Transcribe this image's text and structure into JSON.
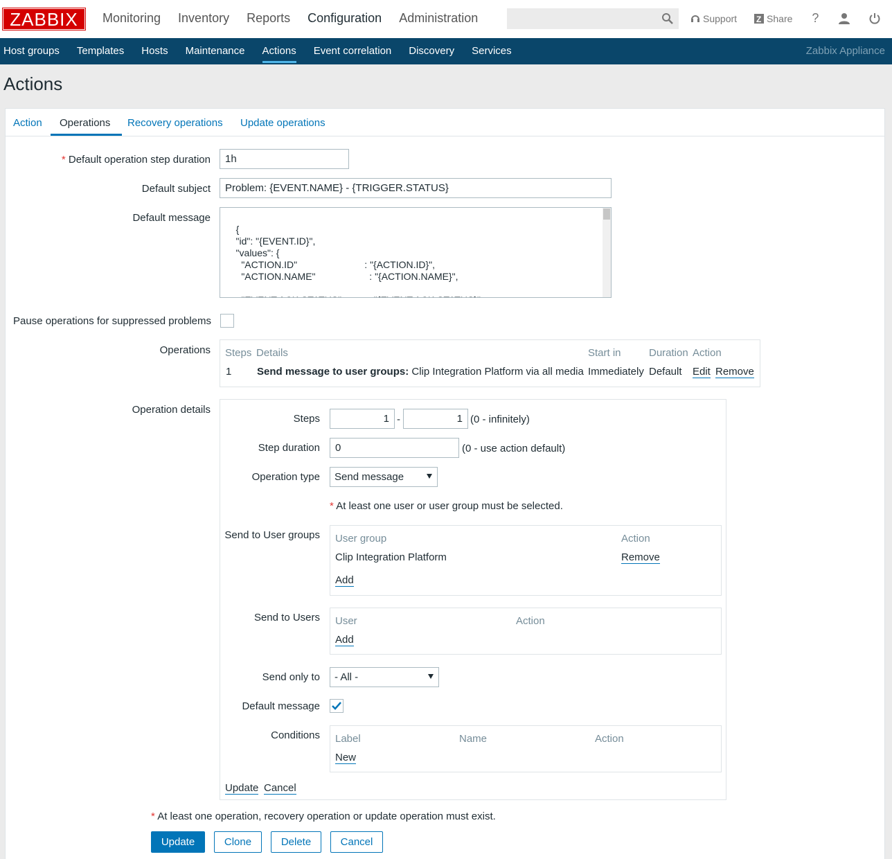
{
  "brand": "ZABBIX",
  "top_menu": [
    "Monitoring",
    "Inventory",
    "Reports",
    "Configuration",
    "Administration"
  ],
  "top_icons": {
    "support": "Support",
    "share": "Share",
    "help": "?"
  },
  "sub_menu": [
    "Host groups",
    "Templates",
    "Hosts",
    "Maintenance",
    "Actions",
    "Event correlation",
    "Discovery",
    "Services"
  ],
  "appliance": "Zabbix Appliance",
  "page_title": "Actions",
  "tabs": [
    "Action",
    "Operations",
    "Recovery operations",
    "Update operations"
  ],
  "form": {
    "step_duration_label": "Default operation step duration",
    "step_duration_value": "1h",
    "subject_label": "Default subject",
    "subject_value": "Problem: {EVENT.NAME} - {TRIGGER.STATUS}",
    "message_label": "Default message",
    "message_value": "{\n    \"id\": \"{EVENT.ID}\",\n    \"values\": {\n      \"ACTION.ID\"                         : \"{ACTION.ID}\",\n      \"ACTION.NAME\"                    : \"{ACTION.NAME}\",\n\n      \"EVENT.ACK.STATUS\"          : \"{EVENT.ACK.STATUS}\",\n      \"EVENT.AGE\"                        : \"{EVENT.AGE}\",",
    "pause_label": "Pause operations for suppressed problems",
    "operations_label": "Operations",
    "operations_table": {
      "headers": [
        "Steps",
        "Details",
        "Start in",
        "Duration",
        "Action"
      ],
      "row": {
        "steps": "1",
        "details_bold": "Send message to user groups:",
        "details_rest": " Clip Integration Platform via all media",
        "start_in": "Immediately",
        "duration": "Default",
        "edit": "Edit",
        "remove": "Remove"
      }
    },
    "operation_details_label": "Operation details"
  },
  "details": {
    "steps_label": "Steps",
    "steps_from": "1",
    "steps_dash": "-",
    "steps_to": "1",
    "steps_hint": "(0 - infinitely)",
    "step_duration_label": "Step duration",
    "step_duration_value": "0",
    "step_duration_hint": "(0 - use action default)",
    "operation_type_label": "Operation type",
    "operation_type_value": "Send message",
    "warning": "At least one user or user group must be selected.",
    "user_groups_label": "Send to User groups",
    "user_groups_headers": [
      "User group",
      "Action"
    ],
    "user_group_name": "Clip Integration Platform",
    "user_group_remove": "Remove",
    "user_groups_add": "Add",
    "users_label": "Send to Users",
    "users_headers": [
      "User",
      "Action"
    ],
    "users_add": "Add",
    "send_only_label": "Send only to",
    "send_only_value": "- All -",
    "default_message_label": "Default message",
    "conditions_label": "Conditions",
    "conditions_headers": [
      "Label",
      "Name",
      "Action"
    ],
    "conditions_new": "New",
    "update_link": "Update",
    "cancel_link": "Cancel"
  },
  "footer_warning": "At least one operation, recovery operation or update operation must exist.",
  "buttons": [
    "Update",
    "Clone",
    "Delete",
    "Cancel"
  ],
  "colors": {
    "brand_red": "#d40000",
    "nav_blue": "#0a466a",
    "link_blue": "#0275b8"
  }
}
